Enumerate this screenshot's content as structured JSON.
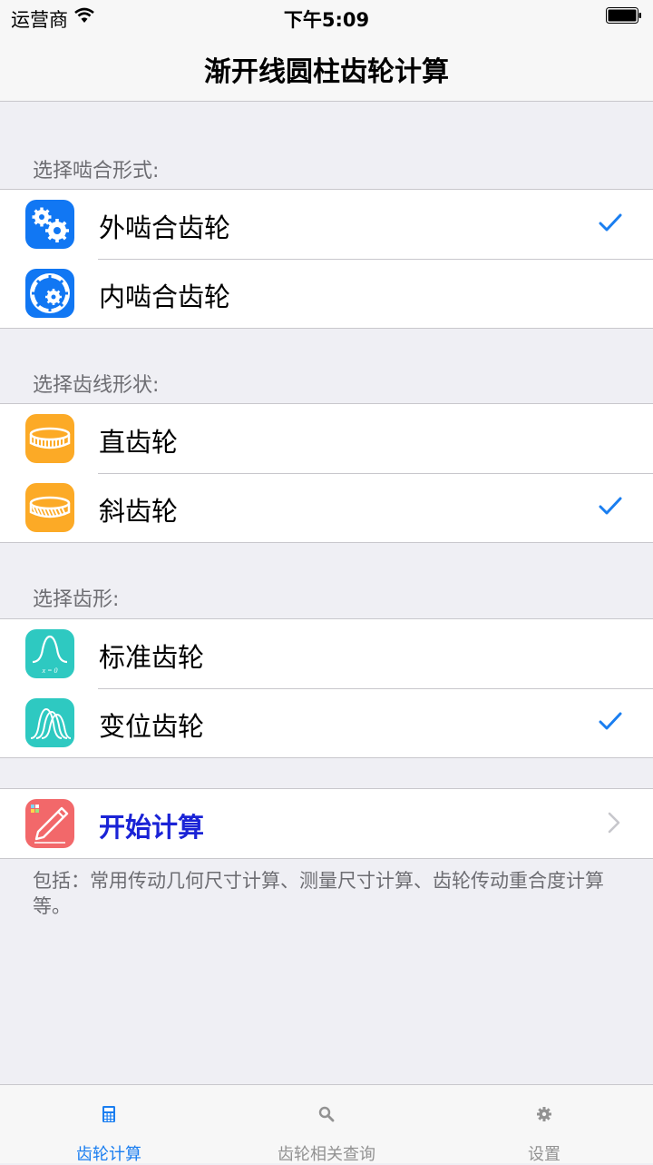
{
  "status_bar": {
    "carrier": "运营商",
    "time": "下午5:09"
  },
  "nav": {
    "title": "渐开线圆柱齿轮计算"
  },
  "sections": [
    {
      "header": "选择啮合形式:",
      "rows": [
        {
          "label": "外啮合齿轮",
          "icon": "external-gear-icon",
          "checked": true
        },
        {
          "label": "内啮合齿轮",
          "icon": "internal-gear-icon",
          "checked": false
        }
      ]
    },
    {
      "header": "选择齿线形状:",
      "rows": [
        {
          "label": "直齿轮",
          "icon": "spur-gear-icon",
          "checked": false
        },
        {
          "label": "斜齿轮",
          "icon": "helical-gear-icon",
          "checked": true
        }
      ]
    },
    {
      "header": "选择齿形:",
      "rows": [
        {
          "label": "标准齿轮",
          "icon": "standard-profile-icon",
          "checked": false
        },
        {
          "label": "变位齿轮",
          "icon": "modified-profile-icon",
          "checked": true
        }
      ]
    }
  ],
  "start": {
    "label": "开始计算",
    "icon": "pencil-icon"
  },
  "icon_texts": {
    "standard_formula": "x = 0"
  },
  "footnote": "包括：常用传动几何尺寸计算、测量尺寸计算、齿轮传动重合度计算等。",
  "tabs": [
    {
      "label": "齿轮计算",
      "icon": "calculator-icon",
      "active": true
    },
    {
      "label": "齿轮相关查询",
      "icon": "search-icon",
      "active": false
    },
    {
      "label": "设置",
      "icon": "gear-icon",
      "active": false
    }
  ],
  "colors": {
    "accent": "#1a7ef0",
    "gear_blue": "#1177f3",
    "orange": "#fcaa26",
    "teal": "#2ec9c1",
    "red": "#f2686a"
  }
}
